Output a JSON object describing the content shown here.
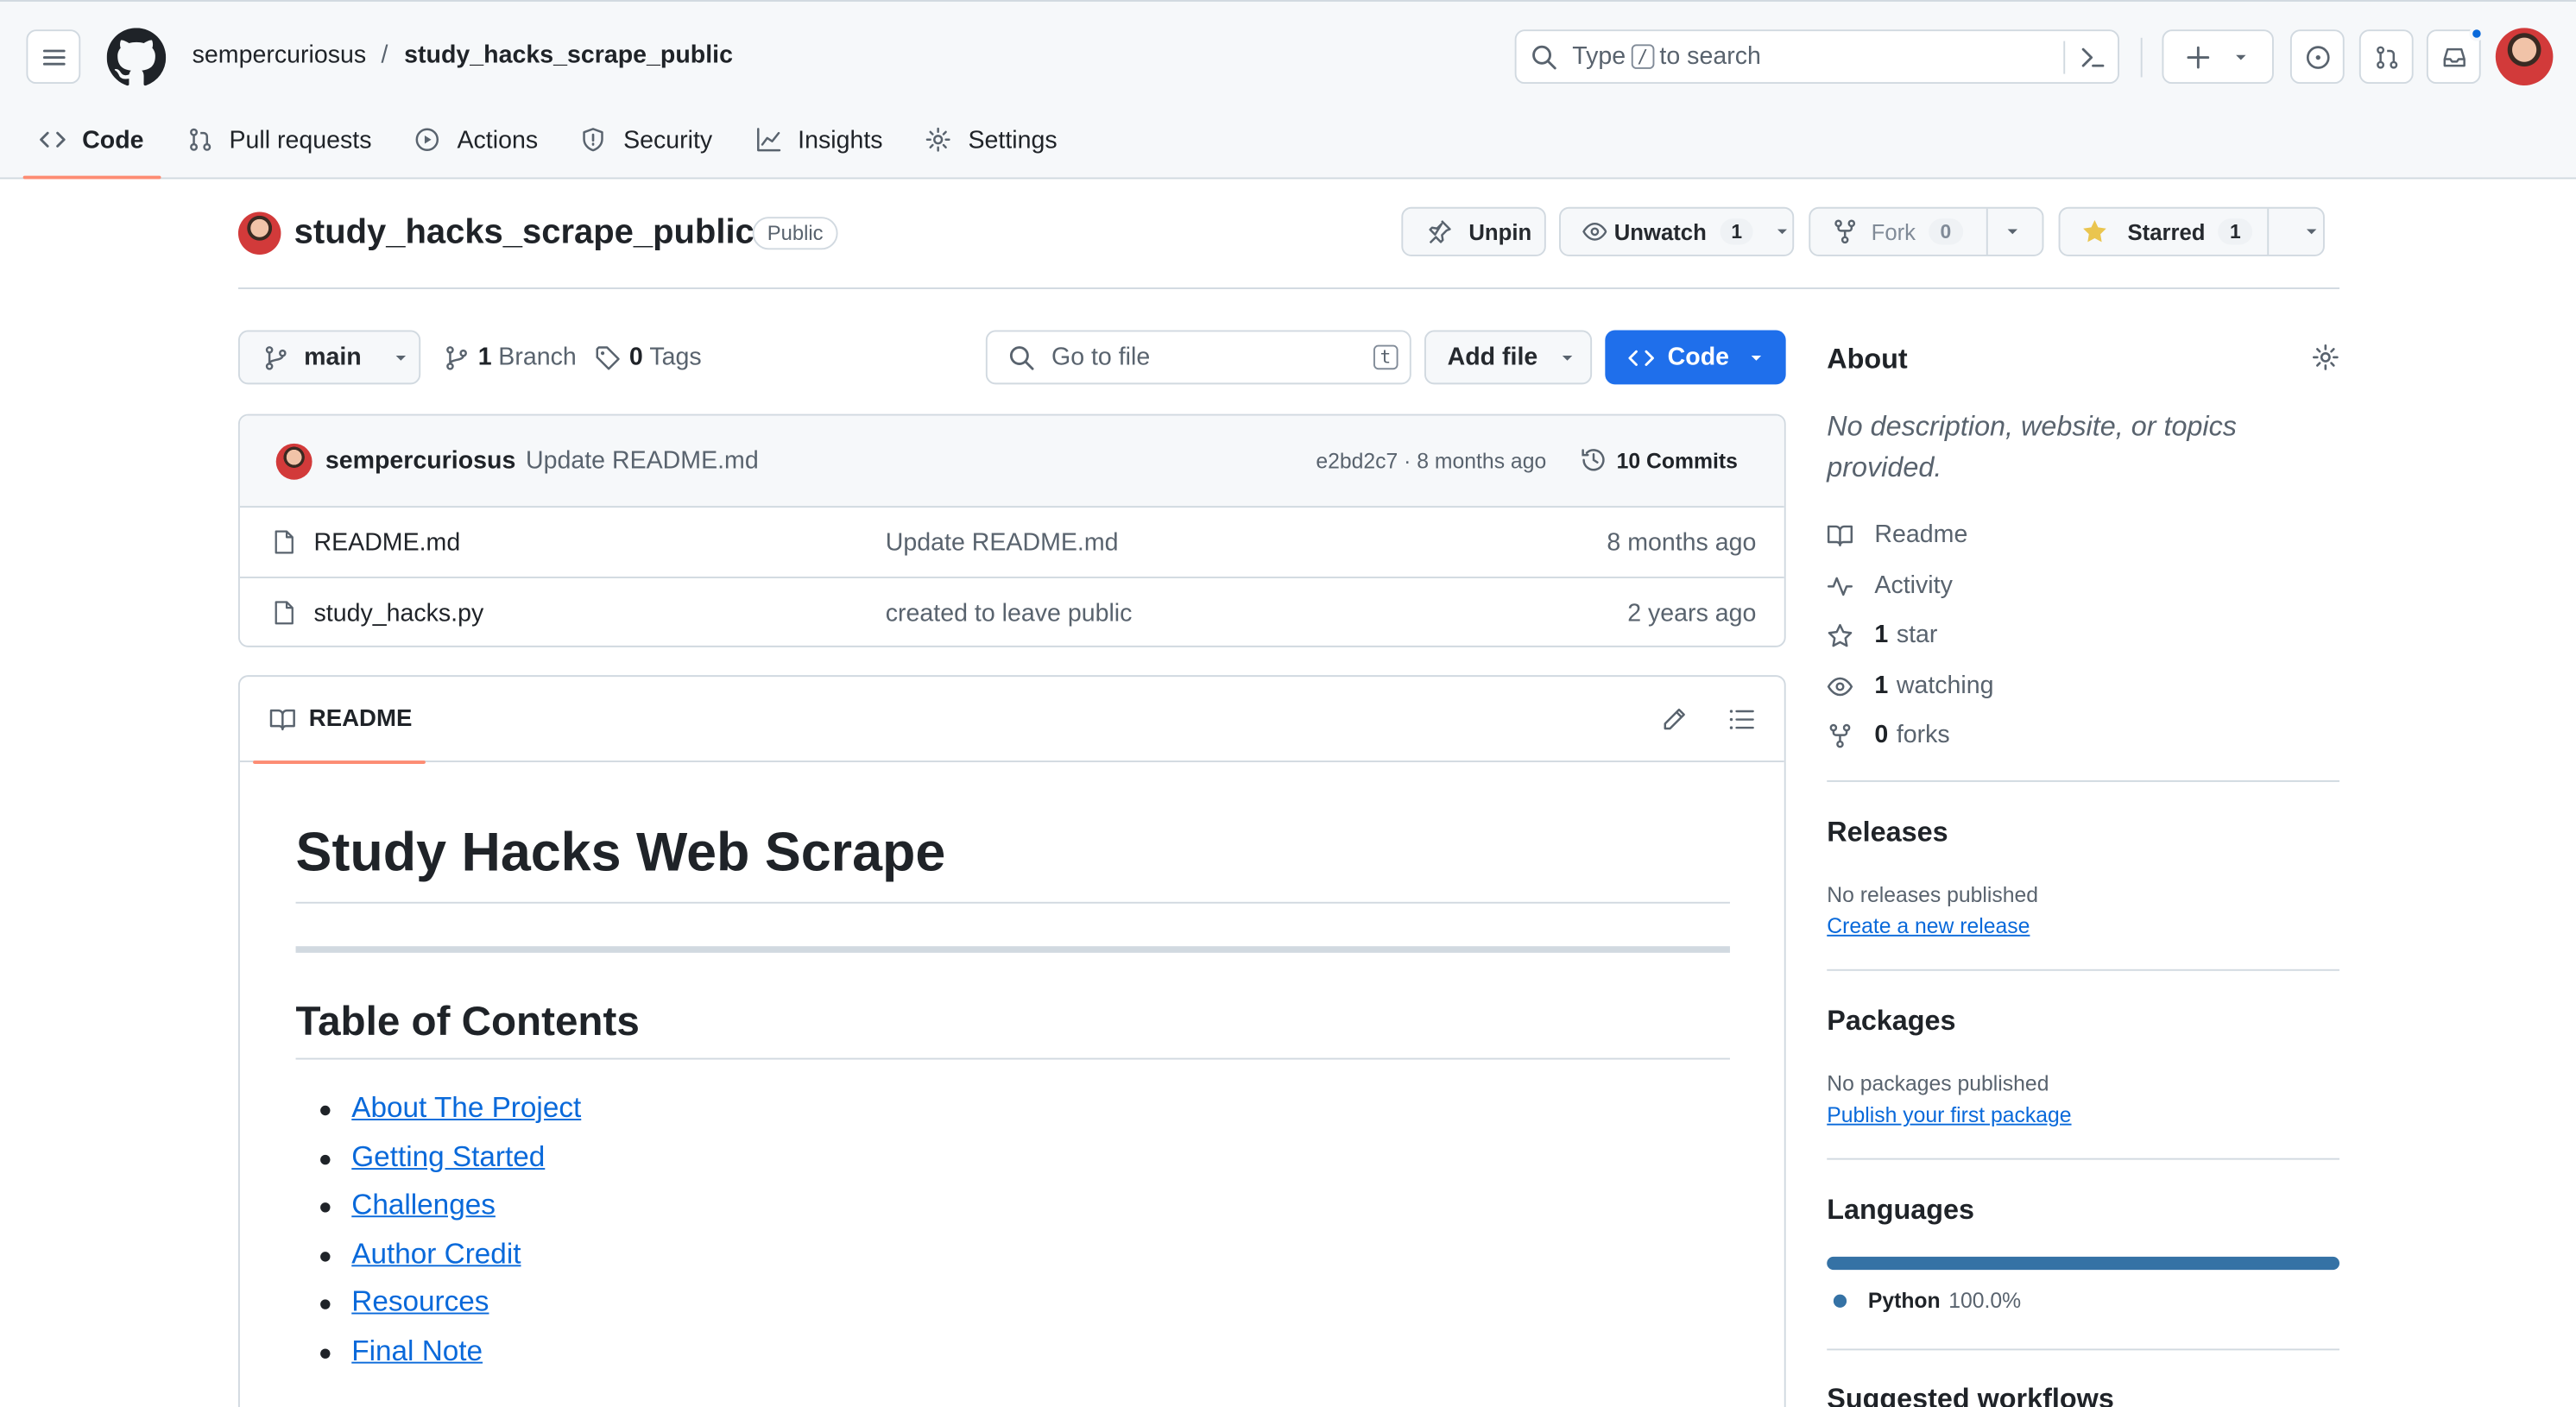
{
  "header": {
    "owner": "sempercuriosus",
    "separator": "/",
    "repo": "study_hacks_scrape_public",
    "search_prefix": "Type",
    "search_key": "/",
    "search_suffix": "to search"
  },
  "tabs": [
    {
      "label": "Code",
      "icon": "code-icon"
    },
    {
      "label": "Pull requests",
      "icon": "pull-request-icon"
    },
    {
      "label": "Actions",
      "icon": "play-icon"
    },
    {
      "label": "Security",
      "icon": "shield-icon"
    },
    {
      "label": "Insights",
      "icon": "graph-icon"
    },
    {
      "label": "Settings",
      "icon": "gear-icon"
    }
  ],
  "repo": {
    "name": "study_hacks_scrape_public",
    "visibility": "Public",
    "unpin": "Unpin",
    "unwatch": "Unwatch",
    "watch_count": "1",
    "fork": "Fork",
    "fork_count": "0",
    "starred": "Starred",
    "star_count": "1"
  },
  "filenav": {
    "branch": "main",
    "branch_count": "1",
    "branch_label": "Branch",
    "tag_count": "0",
    "tag_label": "Tags",
    "goto_placeholder": "Go to file",
    "goto_key": "t",
    "add_file": "Add file",
    "code": "Code"
  },
  "commit": {
    "author": "sempercuriosus",
    "message": "Update README.md",
    "meta": "e2bd2c7 · 8 months ago",
    "commits": "10 Commits"
  },
  "files": [
    {
      "name": "README.md",
      "message": "Update README.md",
      "age": "8 months ago"
    },
    {
      "name": "study_hacks.py",
      "message": "created to leave public",
      "age": "2 years ago"
    }
  ],
  "readme": {
    "tab": "README",
    "title": "Study Hacks Web Scrape",
    "toc_title": "Table of Contents",
    "toc": [
      "About The Project",
      "Getting Started",
      "Challenges",
      "Author Credit",
      "Resources",
      "Final Note"
    ]
  },
  "about": {
    "title": "About",
    "description": "No description, website, or topics provided.",
    "readme": "Readme",
    "activity": "Activity",
    "stars_n": "1",
    "stars": "star",
    "watching_n": "1",
    "watching": "watching",
    "forks_n": "0",
    "forks": "forks"
  },
  "releases": {
    "title": "Releases",
    "none": "No releases published",
    "link": "Create a new release"
  },
  "packages": {
    "title": "Packages",
    "none": "No packages published",
    "link": "Publish your first package"
  },
  "languages": {
    "title": "Languages",
    "name": "Python",
    "percent": "100.0%",
    "color": "#3572A5"
  },
  "suggested": {
    "title": "Suggested workflows"
  }
}
